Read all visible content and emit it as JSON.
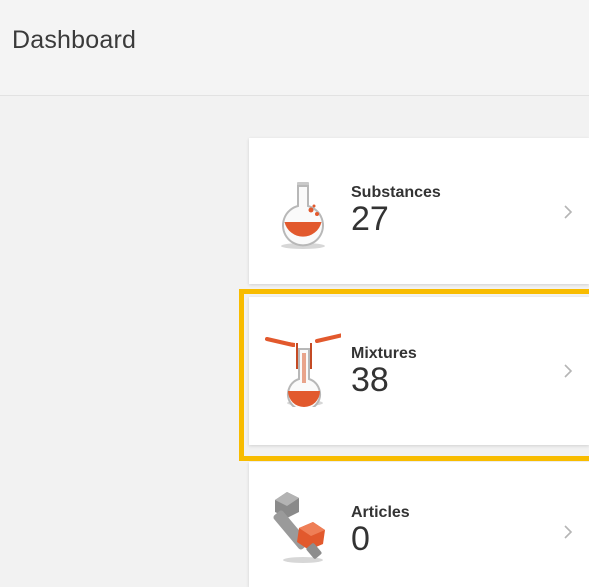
{
  "header": {
    "title": "Dashboard"
  },
  "cards": [
    {
      "label": "Substances",
      "count": "27",
      "icon": "flask-icon"
    },
    {
      "label": "Mixtures",
      "count": "38",
      "icon": "mixing-flasks-icon"
    },
    {
      "label": "Articles",
      "count": "0",
      "icon": "bolt-nut-icon"
    }
  ],
  "colors": {
    "accent_orange": "#e2592d",
    "highlight": "#f8bc00"
  }
}
